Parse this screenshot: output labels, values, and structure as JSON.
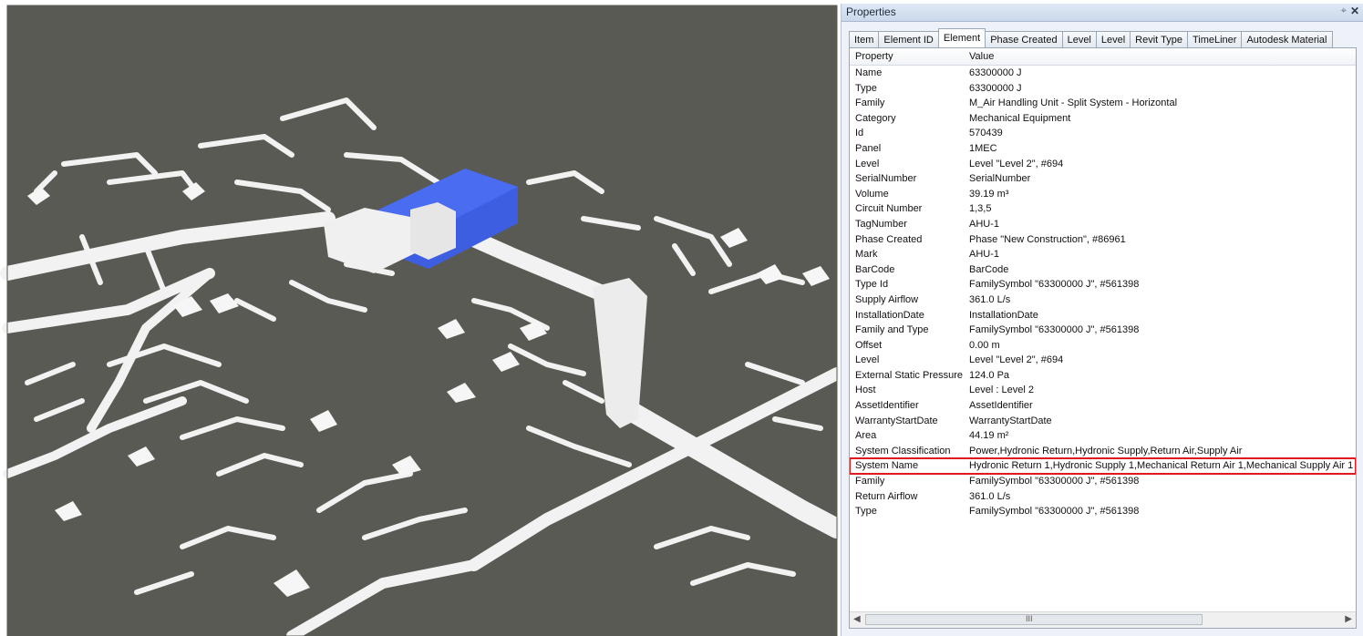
{
  "panel": {
    "title": "Properties",
    "pin_icon": "pin-icon",
    "close_icon": "close-icon",
    "tabs": [
      "Item",
      "Element ID",
      "Element",
      "Phase Created",
      "Level",
      "Level",
      "Revit Type",
      "TimeLiner",
      "Autodesk Material"
    ],
    "active_tab": "Element",
    "header": {
      "property": "Property",
      "value": "Value"
    },
    "rows": [
      [
        "Name",
        "63300000 J"
      ],
      [
        "Type",
        "63300000 J"
      ],
      [
        "Family",
        "M_Air Handling Unit - Split System - Horizontal"
      ],
      [
        "Category",
        "Mechanical Equipment"
      ],
      [
        "Id",
        "570439"
      ],
      [
        "Panel",
        "1MEC"
      ],
      [
        "Level",
        "Level \"Level 2\", #694"
      ],
      [
        "SerialNumber",
        "SerialNumber"
      ],
      [
        "Volume",
        "39.19 m³"
      ],
      [
        "Circuit Number",
        "1,3,5"
      ],
      [
        "TagNumber",
        "AHU-1"
      ],
      [
        "Phase Created",
        "Phase \"New Construction\", #86961"
      ],
      [
        "Mark",
        "AHU-1"
      ],
      [
        "BarCode",
        "BarCode"
      ],
      [
        "Type Id",
        "FamilySymbol \"63300000 J\", #561398"
      ],
      [
        "Supply Airflow",
        "361.0 L/s"
      ],
      [
        "InstallationDate",
        "InstallationDate"
      ],
      [
        "Family and Type",
        "FamilySymbol \"63300000 J\", #561398"
      ],
      [
        "Offset",
        "0.00 m"
      ],
      [
        "Level",
        "Level \"Level 2\", #694"
      ],
      [
        "External Static Pressure",
        "124.0 Pa"
      ],
      [
        "Host",
        "Level : Level 2"
      ],
      [
        "AssetIdentifier",
        "AssetIdentifier"
      ],
      [
        "WarrantyStartDate",
        "WarrantyStartDate"
      ],
      [
        "Area",
        "44.19 m²"
      ],
      [
        "System Classification",
        "Power,Hydronic Return,Hydronic Supply,Return Air,Supply Air"
      ],
      [
        "System Name",
        "Hydronic Return 1,Hydronic Supply 1,Mechanical Return Air 1,Mechanical Supply Air 1"
      ],
      [
        "Family",
        "FamilySymbol \"63300000 J\", #561398"
      ],
      [
        "Return Airflow",
        "361.0 L/s"
      ],
      [
        "Type",
        "FamilySymbol \"63300000 J\", #561398"
      ]
    ],
    "highlighted_row": "System Name",
    "scroll_thumb": "III",
    "colors": {
      "highlight_border": "#e0191f",
      "viewport_bg": "#5a5a55",
      "selected_unit": "#3d5ee0",
      "duct": "#f4f4f4"
    }
  },
  "viewport": {
    "label": "3d-model-view"
  }
}
